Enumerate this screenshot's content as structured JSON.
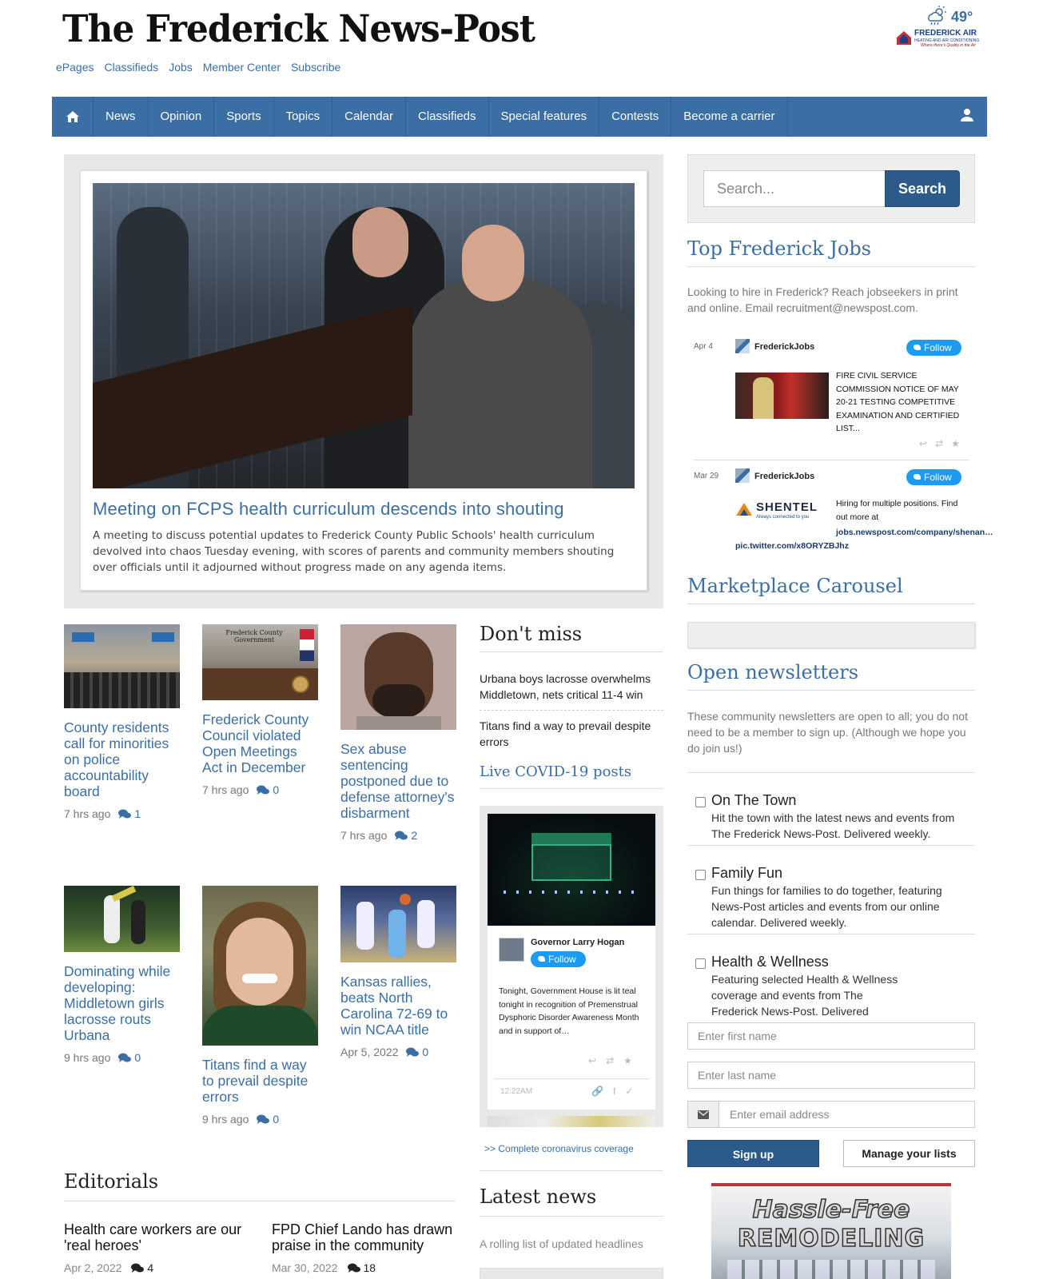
{
  "masthead": {
    "title": "The Frederick News-Post"
  },
  "top_links": [
    "ePages",
    "Classifieds",
    "Jobs",
    "Member Center",
    "Subscribe"
  ],
  "weather": {
    "temp": "49°",
    "icon": "cloud-sun-rain-icon"
  },
  "sponsor": {
    "name": "FREDERICK AIR",
    "sub": "HEATING AND AIR CONDITIONING",
    "tagline": "Where there's Quality in the Air"
  },
  "nav": {
    "items": [
      "News",
      "Opinion",
      "Sports",
      "Topics",
      "Calendar",
      "Classifieds",
      "Special features",
      "Contests",
      "Become a carrier"
    ]
  },
  "lead": {
    "title": "Meeting on FCPS health curriculum descends into shouting",
    "summary": "A meeting to discuss potential updates to Frederick County Public Schools' health curriculum devolved into chaos Tuesday evening, with scores of parents and community members shouting over officials until it adjourned without progress made on any agenda items."
  },
  "stories": [
    {
      "headline": "County residents call for minorities on police accountability board",
      "time": "7 hrs ago",
      "comments": "1"
    },
    {
      "headline": "Frederick County Council violated Open Meetings Act in December",
      "time": "7 hrs ago",
      "comments": "0",
      "thumb_caption": "Frederick County Government"
    },
    {
      "headline": "Sex abuse sentencing postponed due to defense attorney's disbarment",
      "time": "7 hrs ago",
      "comments": "2"
    },
    {
      "headline": "Dominating while developing: Middletown girls lacrosse routs Urbana",
      "time": "9 hrs ago",
      "comments": "0"
    },
    {
      "headline": "Titans find a way to prevail despite errors",
      "time": "9 hrs ago",
      "comments": "0"
    },
    {
      "headline": "Kansas rallies, beats North Carolina 72-69 to win NCAA title",
      "time": "Apr 5, 2022",
      "comments": "0"
    }
  ],
  "dont_miss": {
    "title": "Don't miss",
    "items": [
      "Urbana boys lacrosse overwhelms Middletown, nets critical 11-4 win",
      "Titans find a way to prevail despite errors"
    ]
  },
  "covid": {
    "title": "Live COVID-19 posts",
    "tweet": {
      "author": "Governor Larry Hogan",
      "follow": "Follow",
      "text": "Tonight, Government House is lit teal tonight in recognition of Premenstrual Dysphoric Disorder Awareness Month and in support of…",
      "time": "12:22AM"
    },
    "link": ">> Complete coronavirus coverage"
  },
  "editorials": {
    "title": "Editorials",
    "items": [
      {
        "headline": "Health care workers are our 'real heroes'",
        "date": "Apr 2, 2022",
        "comments": "4"
      },
      {
        "headline": "FPD Chief Lando has drawn praise in the community",
        "date": "Mar 30, 2022",
        "comments": "18"
      }
    ]
  },
  "latest": {
    "title": "Latest news",
    "desc": "A rolling list of updated headlines"
  },
  "search": {
    "placeholder": "Search...",
    "button": "Search"
  },
  "jobs": {
    "title": "Top Frederick Jobs",
    "intro": "Looking to hire in Frederick? Reach jobseekers in print and online. Email recruitment@newspost.com.",
    "tweets": [
      {
        "date": "Apr 4",
        "account": "FrederickJobs",
        "follow": "Follow",
        "text": "FIRE CIVIL SERVICE COMMISSION NOTICE OF MAY 20-21 TESTING COMPETITIVE EXAMINATION AND CERTIFIED LIST..."
      },
      {
        "date": "Mar 29",
        "account": "FrederickJobs",
        "follow": "Follow",
        "text": "Hiring for multiple positions. Find out more at",
        "link": "jobs.newspost.com/company/shenan… pic.twitter.com/x8ORYZBJhz",
        "logo": "SHENTEL",
        "logo_tag": "Always connected to you"
      }
    ]
  },
  "marketplace": {
    "title": "Marketplace Carousel"
  },
  "newsletters": {
    "title": "Open newsletters",
    "intro": "These community newsletters are open to all; you do not need to be a member to sign up. (Although we hope you do join us!)",
    "items": [
      {
        "name": "On The Town",
        "desc": "Hit the town with the latest news and events from The Frederick News-Post. Delivered weekly."
      },
      {
        "name": "Family Fun",
        "desc": "Fun things for families to do together, featuring News-Post articles and events from our online calendar. Delivered weekly."
      },
      {
        "name": "Health & Wellness",
        "desc": "Featuring selected Health & Wellness coverage and events from The Frederick News-Post. Delivered weekly."
      }
    ],
    "first_name_ph": "Enter first name",
    "last_name_ph": "Enter last name",
    "email_ph": "Enter email address",
    "signup": "Sign up",
    "manage": "Manage your lists"
  },
  "ad": {
    "line1": "Hassle-Free",
    "line2": "REMODELING"
  },
  "colors": {
    "brand_blue": "#3a6ea5",
    "button_blue": "#2c5a8a",
    "twitter": "#1d9bf0"
  }
}
